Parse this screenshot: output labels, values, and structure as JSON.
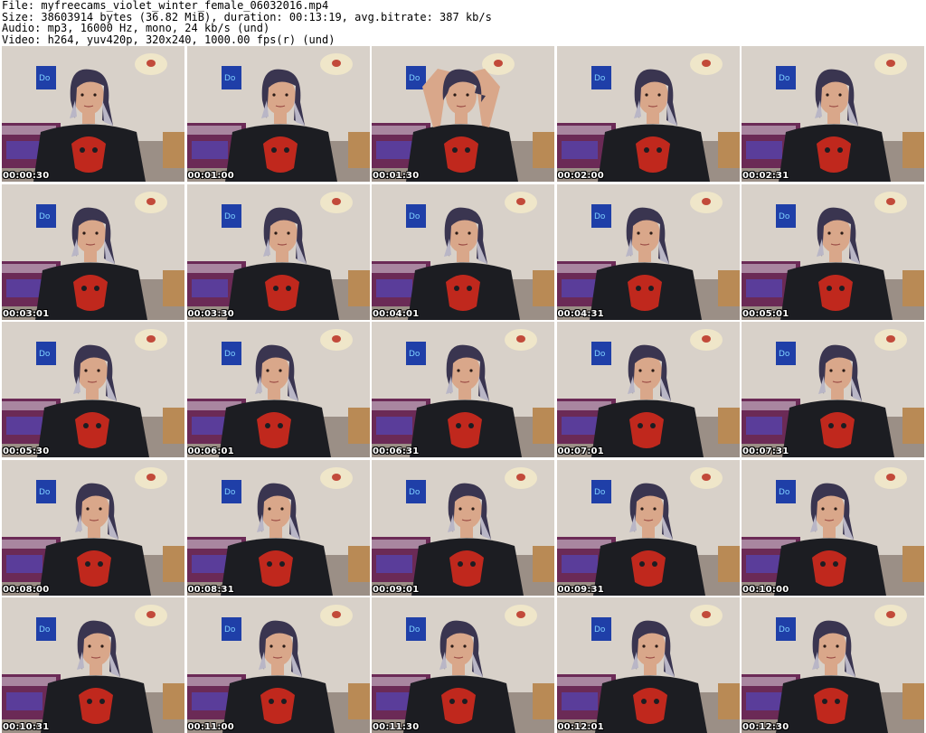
{
  "header": {
    "line1": "File: myfreecams_violet_winter_female_06032016.mp4",
    "line2": "Size: 38603914 bytes (36.82 MiB), duration: 00:13:19, avg.bitrate: 387 kb/s",
    "line3": "Audio: mp3, 16000 Hz, mono, 24 kb/s (und)",
    "line4": "Video: h264, yuv420p, 320x240, 1000.00 fps(r) (und)"
  },
  "thumbnails": [
    {
      "time": "00:00:30"
    },
    {
      "time": "00:01:00"
    },
    {
      "time": "00:01:30"
    },
    {
      "time": "00:02:00"
    },
    {
      "time": "00:02:31"
    },
    {
      "time": "00:03:01"
    },
    {
      "time": "00:03:30"
    },
    {
      "time": "00:04:01"
    },
    {
      "time": "00:04:31"
    },
    {
      "time": "00:05:01"
    },
    {
      "time": "00:05:30"
    },
    {
      "time": "00:06:01"
    },
    {
      "time": "00:06:31"
    },
    {
      "time": "00:07:01"
    },
    {
      "time": "00:07:31"
    },
    {
      "time": "00:08:00"
    },
    {
      "time": "00:08:31"
    },
    {
      "time": "00:09:01"
    },
    {
      "time": "00:09:31"
    },
    {
      "time": "00:10:00"
    },
    {
      "time": "00:10:31"
    },
    {
      "time": "00:11:00"
    },
    {
      "time": "00:11:30"
    },
    {
      "time": "00:12:01"
    },
    {
      "time": "00:12:30"
    }
  ],
  "colors": {
    "wall": "#d8d1c9",
    "shirt": "#1c1d22",
    "skull": "#c0281d",
    "hair": "#3a3550",
    "hair_tips": "#b9b6c6",
    "skin": "#d9a78a",
    "bed": "#6b2a56",
    "poster": "#1f3fa8"
  }
}
